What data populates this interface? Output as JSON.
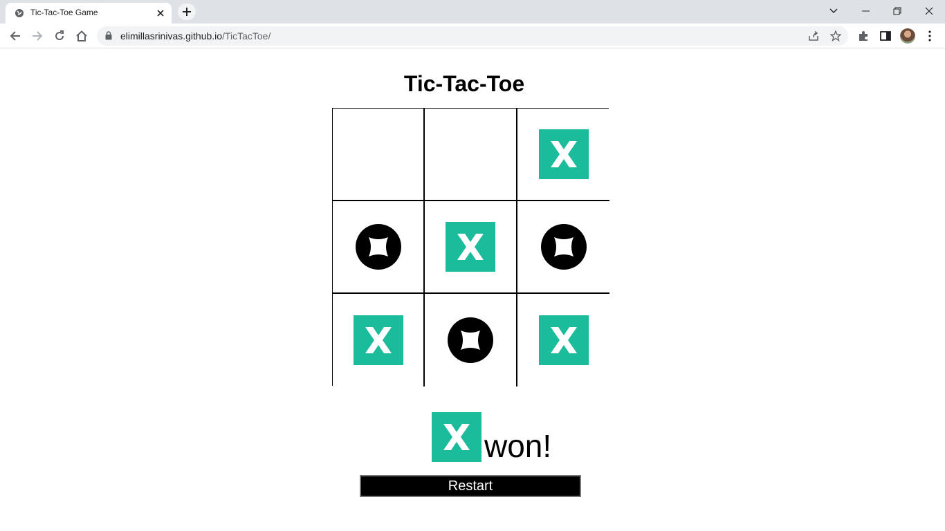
{
  "browser": {
    "tab_title": "Tic-Tac-Toe Game",
    "url_host": "elimillasrinivas.github.io",
    "url_path": "/TicTacToe/"
  },
  "page": {
    "title": "Tic-Tac-Toe",
    "board": [
      "",
      "",
      "X",
      "O",
      "X",
      "O",
      "X",
      "O",
      "X"
    ],
    "winner": "X",
    "result_text": "won!",
    "restart_label": "Restart"
  },
  "colors": {
    "x_mark": "#1abc9c",
    "o_mark": "#000000",
    "restart_bg": "#000000"
  }
}
